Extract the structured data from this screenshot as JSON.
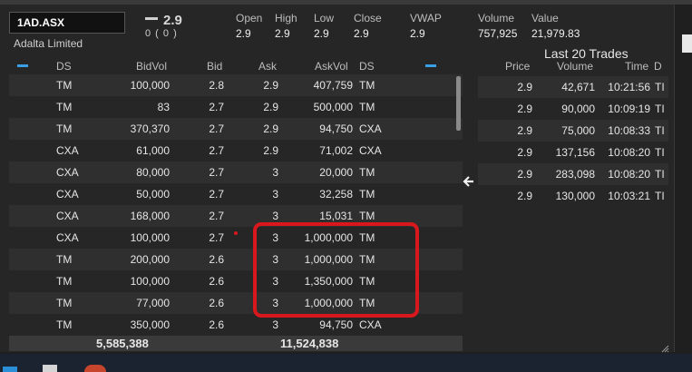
{
  "quote": {
    "symbol": "1AD.ASX",
    "company": "Adalta Limited",
    "last": "2.9",
    "change": "0 ( 0 )",
    "fields": [
      {
        "label": "Open",
        "value": "2.9"
      },
      {
        "label": "High",
        "value": "2.9"
      },
      {
        "label": "Low",
        "value": "2.9"
      },
      {
        "label": "Close",
        "value": "2.9"
      },
      {
        "label": "VWAP",
        "value": "2.9"
      },
      {
        "label": "Volume",
        "value": "757,925"
      },
      {
        "label": "Value",
        "value": "21,979.83"
      }
    ]
  },
  "depth": {
    "headers": {
      "ds_left": "DS",
      "bidvol": "BidVol",
      "bid": "Bid",
      "ask": "Ask",
      "askvol": "AskVol",
      "ds_right": "DS"
    },
    "rows": [
      {
        "ds_bid": "TM",
        "bidvol": "100,000",
        "bid": "2.8",
        "ask": "2.9",
        "askvol": "407,759",
        "ds_ask": "TM"
      },
      {
        "ds_bid": "TM",
        "bidvol": "83",
        "bid": "2.7",
        "ask": "2.9",
        "askvol": "500,000",
        "ds_ask": "TM"
      },
      {
        "ds_bid": "TM",
        "bidvol": "370,370",
        "bid": "2.7",
        "ask": "2.9",
        "askvol": "94,750",
        "ds_ask": "CXA"
      },
      {
        "ds_bid": "CXA",
        "bidvol": "61,000",
        "bid": "2.7",
        "ask": "2.9",
        "askvol": "71,002",
        "ds_ask": "CXA"
      },
      {
        "ds_bid": "CXA",
        "bidvol": "80,000",
        "bid": "2.7",
        "ask": "3",
        "askvol": "20,000",
        "ds_ask": "TM"
      },
      {
        "ds_bid": "CXA",
        "bidvol": "50,000",
        "bid": "2.7",
        "ask": "3",
        "askvol": "32,258",
        "ds_ask": "TM"
      },
      {
        "ds_bid": "CXA",
        "bidvol": "168,000",
        "bid": "2.7",
        "ask": "3",
        "askvol": "15,031",
        "ds_ask": "TM"
      },
      {
        "ds_bid": "CXA",
        "bidvol": "100,000",
        "bid": "2.7",
        "ask": "3",
        "askvol": "1,000,000",
        "ds_ask": "TM"
      },
      {
        "ds_bid": "TM",
        "bidvol": "200,000",
        "bid": "2.6",
        "ask": "3",
        "askvol": "1,000,000",
        "ds_ask": "TM"
      },
      {
        "ds_bid": "TM",
        "bidvol": "100,000",
        "bid": "2.6",
        "ask": "3",
        "askvol": "1,350,000",
        "ds_ask": "TM"
      },
      {
        "ds_bid": "TM",
        "bidvol": "77,000",
        "bid": "2.6",
        "ask": "3",
        "askvol": "1,000,000",
        "ds_ask": "TM"
      },
      {
        "ds_bid": "TM",
        "bidvol": "350,000",
        "bid": "2.6",
        "ask": "3",
        "askvol": "94,750",
        "ds_ask": "CXA"
      }
    ],
    "total_bidvol": "5,585,388",
    "total_askvol": "11,524,838"
  },
  "trades": {
    "title": "Last 20 Trades",
    "headers": {
      "price": "Price",
      "volume": "Volume",
      "time": "Time",
      "extra": "D"
    },
    "rows": [
      {
        "price": "2.9",
        "volume": "42,671",
        "time": "10:21:56",
        "extra": "TI"
      },
      {
        "price": "2.9",
        "volume": "90,000",
        "time": "10:09:19",
        "extra": "TI"
      },
      {
        "price": "2.9",
        "volume": "75,000",
        "time": "10:08:33",
        "extra": "TI"
      },
      {
        "price": "2.9",
        "volume": "137,156",
        "time": "10:08:20",
        "extra": "TI"
      },
      {
        "price": "2.9",
        "volume": "283,098",
        "time": "10:08:20",
        "extra": "TI"
      },
      {
        "price": "2.9",
        "volume": "130,000",
        "time": "10:03:21",
        "extra": "TI"
      }
    ]
  },
  "icons": {
    "collapse_left": "minus-icon",
    "collapse_right": "minus-icon",
    "panel_toggle": "arrow-left-icon",
    "resize": "resize-grip-icon"
  },
  "colors": {
    "annotation": "#d8181d",
    "accent": "#3aa0e6",
    "row_alt": "#2f2f2f",
    "background": "#262626"
  }
}
